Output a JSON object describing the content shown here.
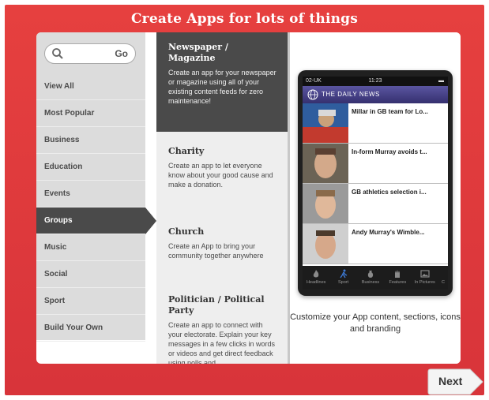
{
  "header": {
    "title": "Create Apps for lots of things"
  },
  "search": {
    "go_label": "Go"
  },
  "sidebar": {
    "items": [
      {
        "label": "View All"
      },
      {
        "label": "Most Popular"
      },
      {
        "label": "Business"
      },
      {
        "label": "Education"
      },
      {
        "label": "Events"
      },
      {
        "label": "Groups",
        "active": true
      },
      {
        "label": "Music"
      },
      {
        "label": "Social"
      },
      {
        "label": "Sport"
      },
      {
        "label": "Build Your Own"
      }
    ]
  },
  "templates": [
    {
      "title": "Newspaper / Magazine",
      "description": "Create an app for your newspaper or magazine using all of your existing content feeds for zero maintenance!",
      "selected": true
    },
    {
      "title": "Charity",
      "description": "Create an app to let everyone know about your good cause and make a donation."
    },
    {
      "title": "Church",
      "description": "Create an App to bring your community together anywhere"
    },
    {
      "title": "Politician / Political Party",
      "description": "Create an app to connect with your electorate. Explain your key messages in a few clicks in words or videos and get direct feedback using polls and"
    }
  ],
  "preview": {
    "status": {
      "carrier": "02-UK",
      "time": "11:23"
    },
    "app_title": "THE DAILY NEWS",
    "news": [
      {
        "title": "Millar in GB team for Lo..."
      },
      {
        "title": "In-form Murray avoids t..."
      },
      {
        "title": "GB athletics selection i..."
      },
      {
        "title": "Andy Murray's Wimble..."
      }
    ],
    "tabs": [
      {
        "label": "Headlines",
        "icon": "flame-icon"
      },
      {
        "label": "Sport",
        "icon": "runner-icon"
      },
      {
        "label": "Business",
        "icon": "money-bag-icon"
      },
      {
        "label": "Features",
        "icon": "hand-icon"
      },
      {
        "label": "In Pictures",
        "icon": "picture-icon"
      },
      {
        "label": "C",
        "icon": ""
      }
    ],
    "caption": "Customize your App content, sections, icons and branding"
  },
  "footer": {
    "next_label": "Next"
  },
  "colors": {
    "frame": "#e0393f",
    "active": "#4a4a4a",
    "app_bar": "#3f3a80"
  }
}
